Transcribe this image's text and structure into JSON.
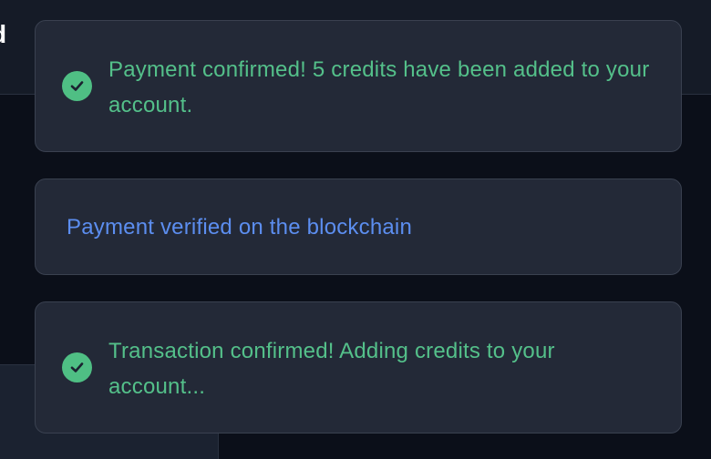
{
  "header": {
    "title_fragment": "d"
  },
  "toasts": [
    {
      "type": "success",
      "icon": "check-circle-icon",
      "message": "Payment confirmed! 5 credits have been added to your account."
    },
    {
      "type": "info",
      "message": "Payment verified on the blockchain"
    },
    {
      "type": "success",
      "icon": "check-circle-icon",
      "message": "Transaction confirmed! Adding credits to your account..."
    }
  ],
  "colors": {
    "success": "#54c08a",
    "info": "#5c8ef0",
    "toast_bg": "#232937",
    "page_bg": "#0b0f19"
  }
}
